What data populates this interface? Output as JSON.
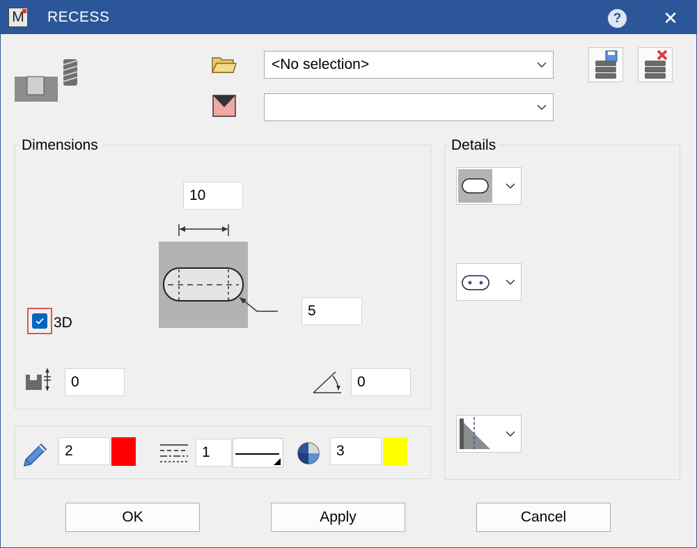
{
  "window": {
    "title": "RECESS",
    "app_icon_letter": "M"
  },
  "header": {
    "selection_combo": {
      "value": "<No selection>"
    },
    "color_combo": {
      "value": ""
    }
  },
  "dimensions": {
    "label": "Dimensions",
    "length": "10",
    "radius": "5",
    "depth": "0",
    "angle": "0",
    "three_d": {
      "label": "3D",
      "checked": true
    }
  },
  "details": {
    "label": "Details"
  },
  "format": {
    "pen": "2",
    "linetype": "1",
    "layer": "3",
    "pen_color": "#ff0000",
    "layer_color": "#ffff00"
  },
  "buttons": {
    "ok": "OK",
    "apply": "Apply",
    "cancel": "Cancel"
  },
  "colors": {
    "titlebar": "#2b579a",
    "accent": "#0067c0"
  }
}
